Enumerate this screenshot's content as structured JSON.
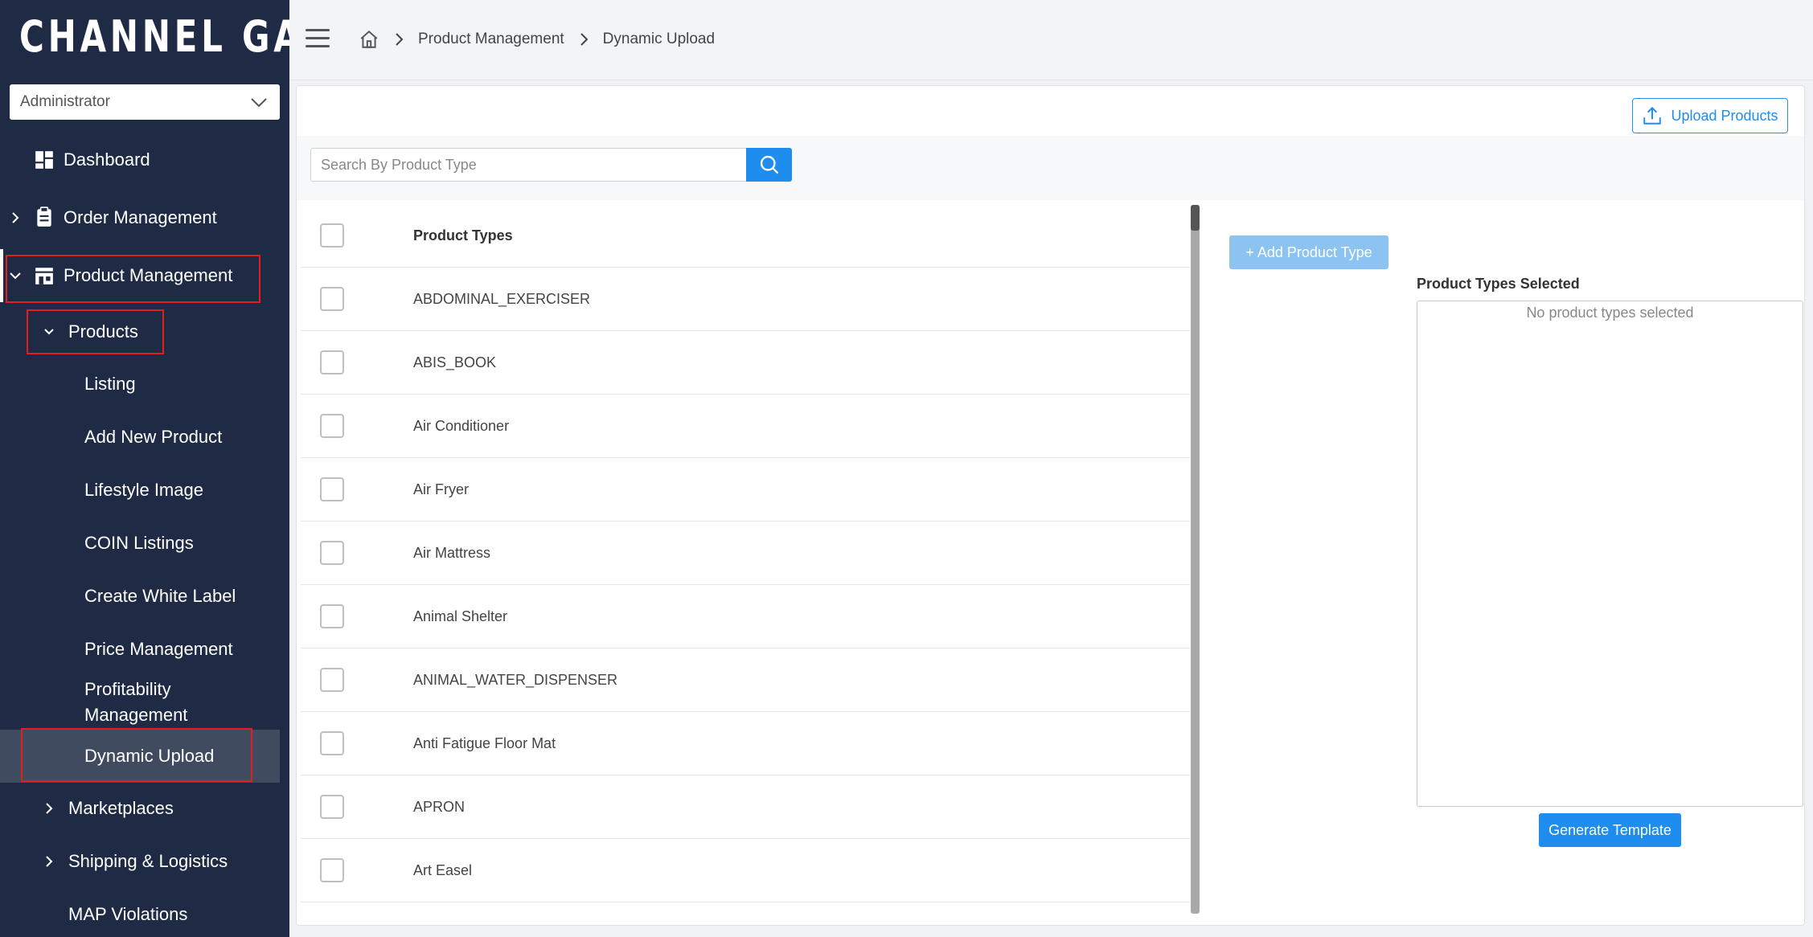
{
  "sidebar": {
    "logo": "CHANNEL GATE",
    "role_select": {
      "value": "Administrator"
    },
    "items": {
      "dashboard": "Dashboard",
      "order_management": "Order Management",
      "product_management": "Product Management",
      "products": "Products",
      "listing": "Listing",
      "add_new_product": "Add New Product",
      "lifestyle_image": "Lifestyle Image",
      "coin_listings": "COIN Listings",
      "create_white_label": "Create White Label",
      "price_management": "Price Management",
      "profitability_line1": "Profitability",
      "profitability_line2": "Management",
      "dynamic_upload": "Dynamic Upload",
      "marketplaces": "Marketplaces",
      "shipping_logistics": "Shipping & Logistics",
      "map_violations": "MAP Violations"
    }
  },
  "header": {
    "breadcrumb": [
      "Product Management",
      "Dynamic Upload"
    ]
  },
  "main": {
    "upload_button": "Upload Products",
    "search": {
      "placeholder": "Search By Product Type",
      "value": ""
    },
    "table": {
      "header": "Product Types",
      "rows": [
        "ABDOMINAL_EXERCISER",
        "ABIS_BOOK",
        "Air Conditioner",
        "Air Fryer",
        "Air Mattress",
        "Animal Shelter",
        "ANIMAL_WATER_DISPENSER",
        "Anti Fatigue Floor Mat",
        "APRON",
        "Art Easel"
      ]
    },
    "add_product_type_button": "+ Add Product Type",
    "selected_label": "Product Types Selected",
    "selected_empty": "No product types selected",
    "generate_button": "Generate Template"
  },
  "colors": {
    "sidebar_bg": "#1f2a44",
    "accent": "#1f8ded",
    "highlight_box": "#e02020",
    "active_item_bg": "#414b5f"
  }
}
